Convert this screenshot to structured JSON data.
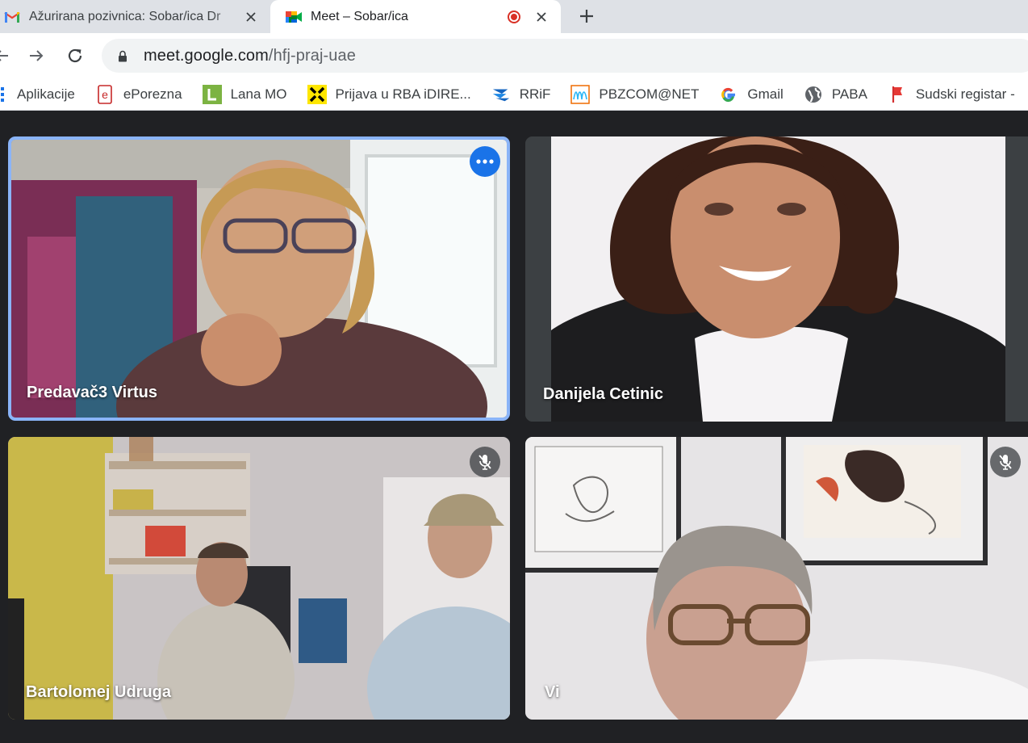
{
  "browser": {
    "tabs": [
      {
        "title": "Ažurirana pozivnica: Sobar/ica Dr",
        "favicon": "gmail-icon",
        "active": false
      },
      {
        "title": "Meet – Sobar/ica",
        "favicon": "google-meet-icon",
        "active": true,
        "recording": true
      }
    ],
    "url": {
      "host": "meet.google.com",
      "path": "/hfj-praj-uae"
    }
  },
  "bookmarks": [
    {
      "label": "Aplikacije",
      "icon": "apps-grid-icon"
    },
    {
      "label": "ePorezna",
      "icon": "eporezna-icon"
    },
    {
      "label": "Lana MO",
      "icon": "lana-l-icon"
    },
    {
      "label": "Prijava u RBA iDIRE...",
      "icon": "raiffeisen-icon"
    },
    {
      "label": "RRiF",
      "icon": "rrif-icon"
    },
    {
      "label": "PBZCOM@NET",
      "icon": "pbz-icon"
    },
    {
      "label": "Gmail",
      "icon": "google-g-icon"
    },
    {
      "label": "PABA",
      "icon": "globe-icon"
    },
    {
      "label": "Sudski registar -",
      "icon": "red-flag-icon"
    }
  ],
  "meeting": {
    "participants": [
      {
        "name": "Predavač3 Virtus",
        "speaking": true,
        "muted": false
      },
      {
        "name": "Danijela Cetinic",
        "speaking": false,
        "muted": false
      },
      {
        "name": "Bartolomej Udruga",
        "speaking": false,
        "muted": true
      },
      {
        "name": "Vi",
        "speaking": false,
        "muted": true
      }
    ]
  },
  "colors": {
    "accent": "#1a73e8",
    "speaking_border": "#8ab4f8",
    "background": "#202124",
    "tile": "#3c4043"
  }
}
